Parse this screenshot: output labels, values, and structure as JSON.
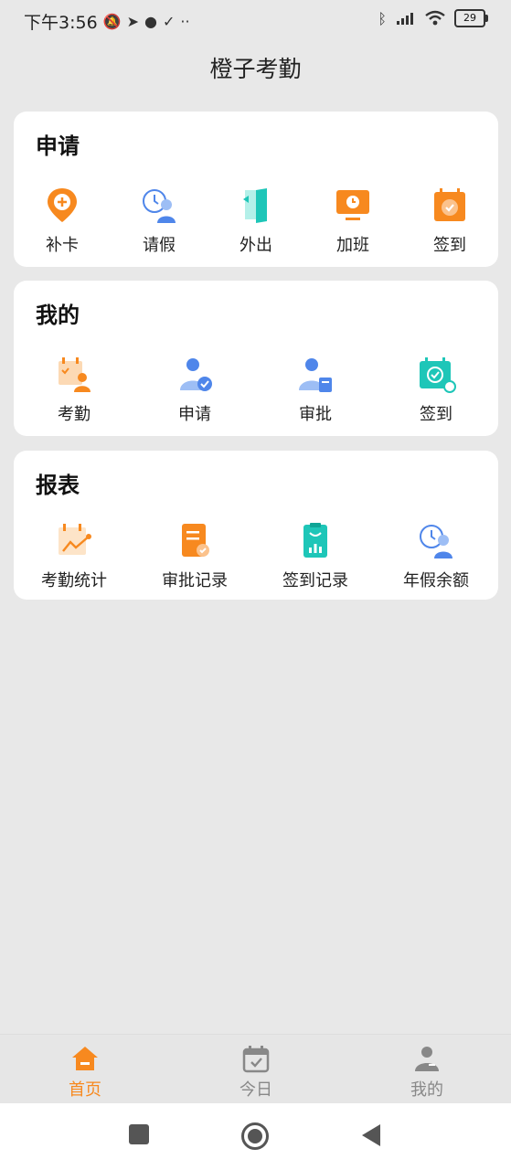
{
  "status_bar": {
    "time": "下午3:56",
    "battery": "29"
  },
  "title": "橙子考勤",
  "sections": {
    "apply": {
      "title": "申请",
      "items": [
        "补卡",
        "请假",
        "外出",
        "加班",
        "签到"
      ]
    },
    "mine": {
      "title": "我的",
      "items": [
        "考勤",
        "申请",
        "审批",
        "签到"
      ]
    },
    "report": {
      "title": "报表",
      "items": [
        "考勤统计",
        "审批记录",
        "签到记录",
        "年假余额"
      ]
    }
  },
  "bottom_nav": {
    "active_color": "#f7891f",
    "inactive_color": "#888888",
    "tabs": [
      "首页",
      "今日",
      "我的"
    ]
  },
  "colors": {
    "orange": "#f7891f",
    "blue": "#4f86ea",
    "teal": "#1ec6b8"
  }
}
